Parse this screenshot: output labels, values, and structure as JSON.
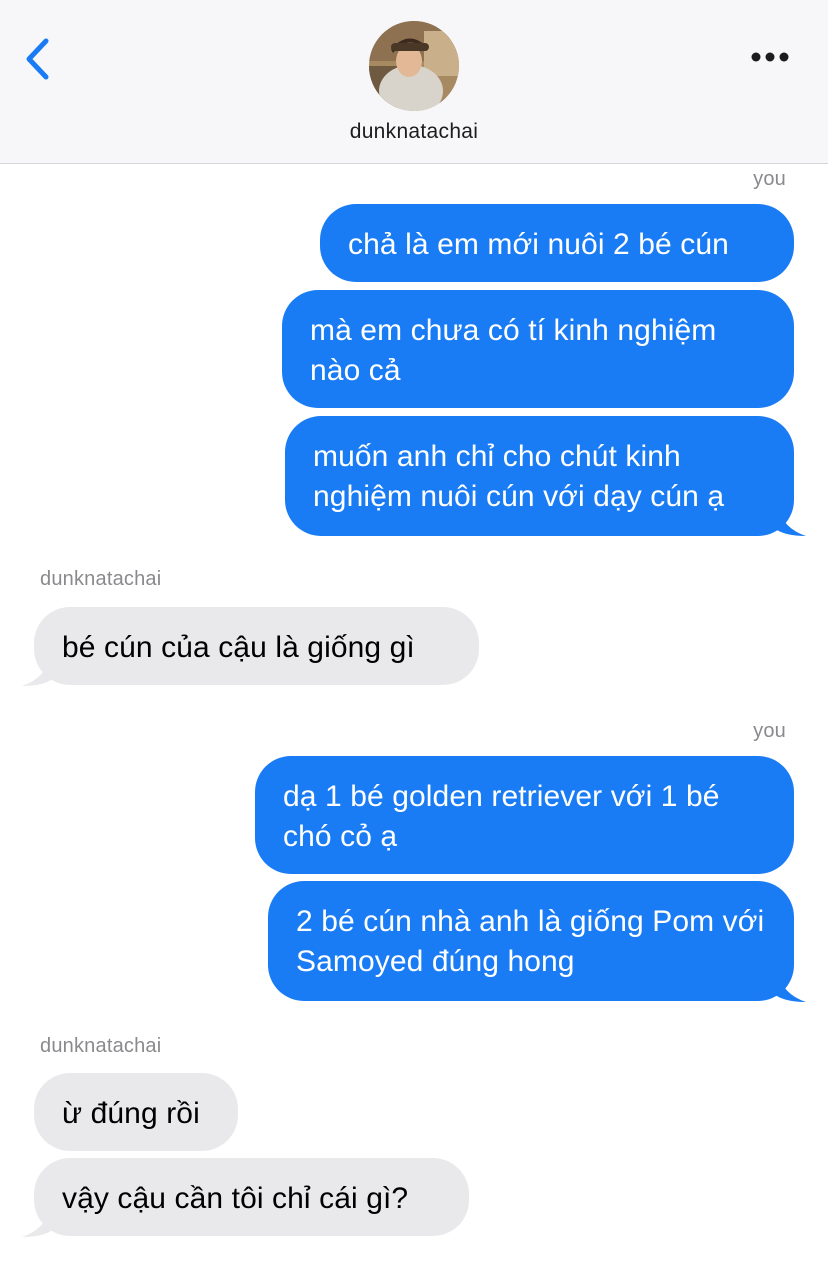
{
  "header": {
    "contact_name": "dunknatachai",
    "back_icon": "chevron-left-icon",
    "more_icon": "ellipsis-icon",
    "accent_color": "#1a7cf5"
  },
  "colors": {
    "outgoing_bubble": "#1a7cf5",
    "incoming_bubble": "#e9e9eb"
  },
  "conversation": {
    "group1": {
      "sender": "you",
      "messages": [
        "chả là em mới nuôi 2 bé cún",
        "mà em chưa có tí kinh nghiệm nào cả",
        "muốn anh chỉ cho chút kinh nghiệm nuôi cún với dạy cún ạ"
      ]
    },
    "group2": {
      "sender": "dunknatachai",
      "messages": [
        "bé cún của cậu là giống gì"
      ]
    },
    "group3": {
      "sender": "you",
      "messages": [
        "dạ 1 bé golden retriever với 1 bé chó cỏ ạ",
        "2 bé cún nhà anh là giống Pom với Samoyed đúng hong"
      ]
    },
    "group4": {
      "sender": "dunknatachai",
      "messages": [
        "ừ đúng rồi",
        "vậy cậu cần tôi chỉ cái gì?"
      ]
    }
  }
}
